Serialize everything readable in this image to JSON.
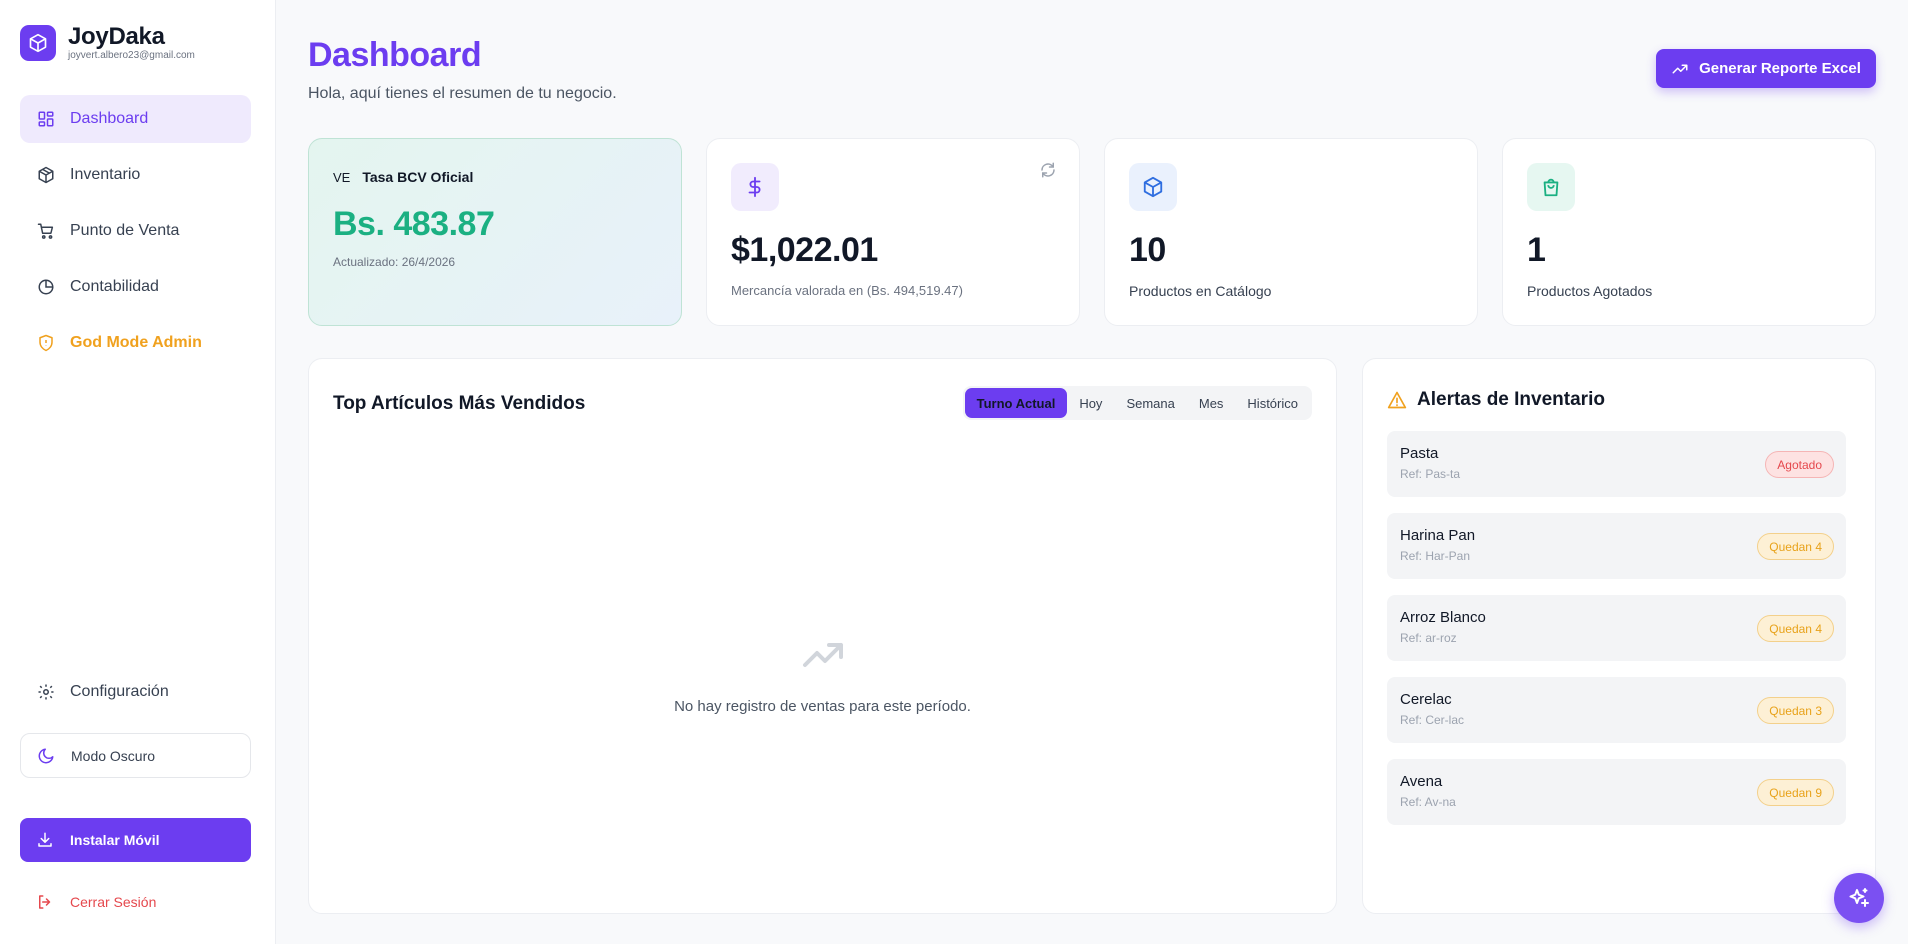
{
  "brand": {
    "name": "JoyDaka",
    "email": "joyvert.albero23@gmail.com"
  },
  "sidebar": {
    "items": [
      {
        "label": "Dashboard",
        "icon": "grid-icon"
      },
      {
        "label": "Inventario",
        "icon": "package-icon"
      },
      {
        "label": "Punto de Venta",
        "icon": "cart-icon"
      },
      {
        "label": "Contabilidad",
        "icon": "pie-chart-icon"
      },
      {
        "label": "God Mode Admin",
        "icon": "shield-icon"
      }
    ],
    "config_label": "Configuración",
    "dark_mode_label": "Modo Oscuro",
    "install_label": "Instalar Móvil",
    "logout_label": "Cerrar Sesión"
  },
  "header": {
    "title": "Dashboard",
    "subtitle": "Hola, aquí tienes el resumen de tu negocio.",
    "report_button": "Generar Reporte Excel"
  },
  "bcv": {
    "flag": "VE",
    "label": "Tasa BCV Oficial",
    "value": "Bs. 483.87",
    "updated": "Actualizado: 26/4/2026"
  },
  "stats": [
    {
      "value": "$1,022.01",
      "label": "Mercancía valorada en (Bs. 494,519.47)",
      "icon": "dollar-icon"
    },
    {
      "value": "10",
      "label": "Productos en Catálogo",
      "icon": "box-icon"
    },
    {
      "value": "1",
      "label": "Productos Agotados",
      "icon": "shopping-bag-icon"
    }
  ],
  "top_sold": {
    "title": "Top Artículos Más Vendidos",
    "tabs": [
      "Turno Actual",
      "Hoy",
      "Semana",
      "Mes",
      "Histórico"
    ],
    "active_tab": "Turno Actual",
    "empty_text": "No hay registro de ventas para este período."
  },
  "alerts": {
    "title": "Alertas de Inventario",
    "items": [
      {
        "name": "Pasta",
        "ref": "Ref: Pas-ta",
        "badge": "Agotado",
        "status": "red"
      },
      {
        "name": "Harina Pan",
        "ref": "Ref: Har-Pan",
        "badge": "Quedan 4",
        "status": "yellow"
      },
      {
        "name": "Arroz Blanco",
        "ref": "Ref: ar-roz",
        "badge": "Quedan 4",
        "status": "yellow"
      },
      {
        "name": "Cerelac",
        "ref": "Ref: Cer-lac",
        "badge": "Quedan 3",
        "status": "yellow"
      },
      {
        "name": "Avena",
        "ref": "Ref: Av-na",
        "badge": "Quedan 9",
        "status": "yellow"
      }
    ]
  },
  "colors": {
    "accent": "#6c3df0",
    "success": "#1bb082",
    "warning": "#f0a11e",
    "danger": "#e5484d"
  }
}
